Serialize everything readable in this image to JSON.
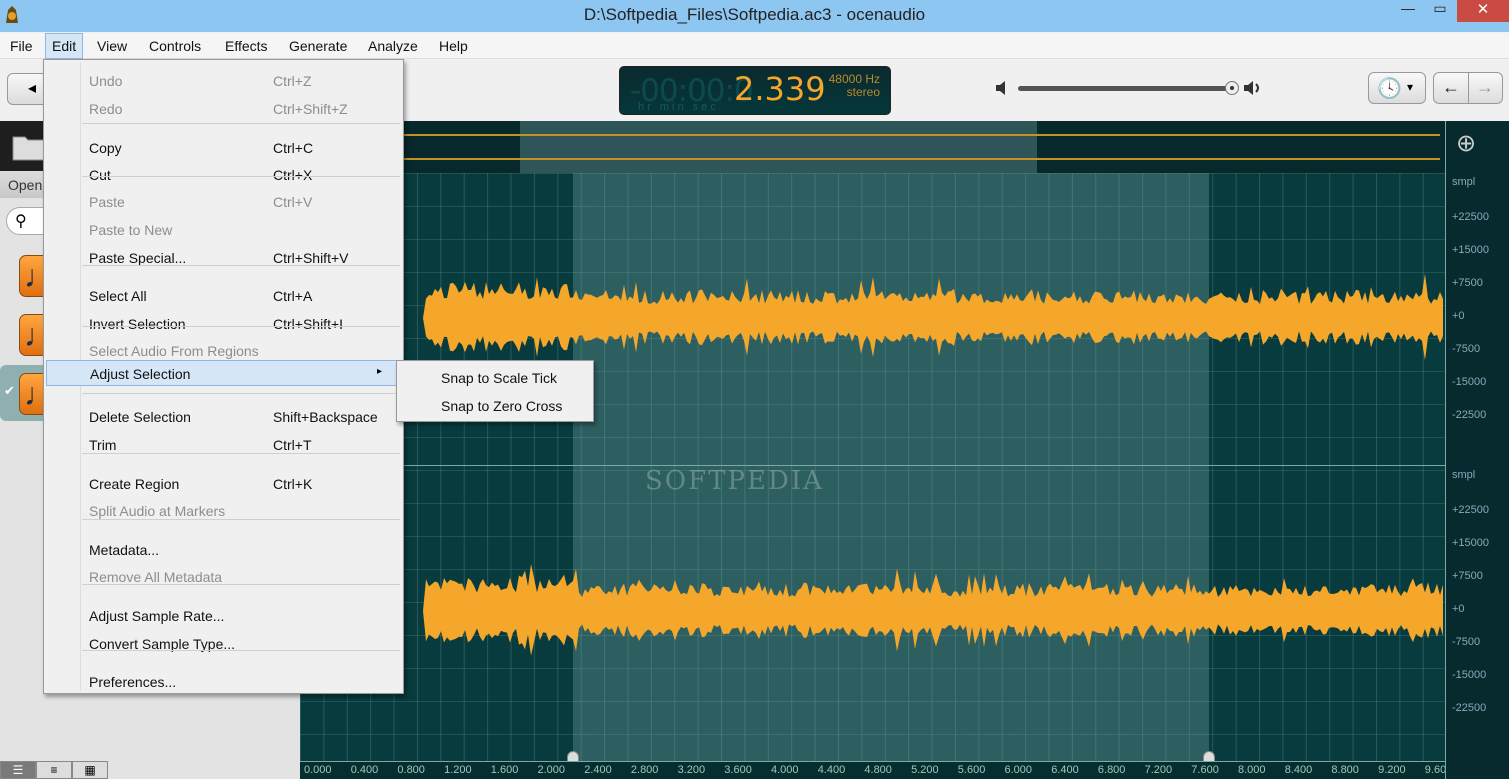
{
  "window": {
    "title": "D:\\Softpedia_Files\\Softpedia.ac3 - ocenaudio",
    "minimize_glyph": "—",
    "maximize_glyph": "▭",
    "close_glyph": "✕"
  },
  "menubar": {
    "items": [
      {
        "label": "File"
      },
      {
        "label": "Edit"
      },
      {
        "label": "View"
      },
      {
        "label": "Controls"
      },
      {
        "label": "Effects"
      },
      {
        "label": "Generate"
      },
      {
        "label": "Analyze"
      },
      {
        "label": "Help"
      }
    ],
    "active": "Edit"
  },
  "toolbar": {
    "sidebar_toggle_glyph": "◂",
    "time_display": {
      "dim_digits": "-00:00:0",
      "time": "2.339",
      "sample_rate": "48000 Hz",
      "channels": "stereo",
      "units": "hr   min sec"
    },
    "volume_percent": 100,
    "clock_glyph": "🕓",
    "dropdown_glyph": "▾",
    "back_glyph": "←",
    "forward_glyph": "→"
  },
  "sidebar": {
    "open_label": "Open",
    "search_glyph": "⚲",
    "view_modes": [
      "☰",
      "≡",
      "▦"
    ]
  },
  "edit_menu": {
    "items": [
      {
        "label": "Undo",
        "shortcut": "Ctrl+Z",
        "enabled": false
      },
      {
        "label": "Redo",
        "shortcut": "Ctrl+Shift+Z",
        "enabled": false
      },
      {
        "label": "Copy",
        "shortcut": "Ctrl+C",
        "enabled": true
      },
      {
        "label": "Cut",
        "shortcut": "Ctrl+X",
        "enabled": true
      },
      {
        "label": "Paste",
        "shortcut": "Ctrl+V",
        "enabled": false
      },
      {
        "label": "Paste to New",
        "shortcut": "",
        "enabled": false
      },
      {
        "label": "Paste Special...",
        "shortcut": "Ctrl+Shift+V",
        "enabled": true
      },
      {
        "label": "Select All",
        "shortcut": "Ctrl+A",
        "enabled": true
      },
      {
        "label": "Invert Selection",
        "shortcut": "Ctrl+Shift+I",
        "enabled": true
      },
      {
        "label": "Select Audio From Regions",
        "shortcut": "",
        "enabled": false
      },
      {
        "label": "Adjust Selection",
        "shortcut": "",
        "enabled": true,
        "submenu": true
      },
      {
        "label": "Delete Selection",
        "shortcut": "Shift+Backspace",
        "enabled": true
      },
      {
        "label": "Trim",
        "shortcut": "Ctrl+T",
        "enabled": true
      },
      {
        "label": "Create Region",
        "shortcut": "Ctrl+K",
        "enabled": true
      },
      {
        "label": "Split Audio at Markers",
        "shortcut": "",
        "enabled": false
      },
      {
        "label": "Metadata...",
        "shortcut": "",
        "enabled": true
      },
      {
        "label": "Remove All Metadata",
        "shortcut": "",
        "enabled": false
      },
      {
        "label": "Adjust Sample Rate...",
        "shortcut": "",
        "enabled": true
      },
      {
        "label": "Convert Sample Type...",
        "shortcut": "",
        "enabled": true
      },
      {
        "label": "Preferences...",
        "shortcut": "",
        "enabled": true
      }
    ],
    "submenu_arrow": "▸"
  },
  "adjust_selection_submenu": {
    "items": [
      {
        "label": "Snap to Scale Tick"
      },
      {
        "label": "Snap to Zero Cross"
      }
    ]
  },
  "waveform": {
    "watermark": "SOFTPEDIA",
    "selection_start_sec": 2.339,
    "selection_end_sec": 7.64,
    "zoom_glyph": "⊕",
    "amplitude_scale": {
      "unit": "smpl",
      "labels": [
        "+22500",
        "+15000",
        "+7500",
        "+0",
        "-7500",
        "-15000",
        "-22500"
      ]
    },
    "time_ruler": [
      "0.000",
      "0.400",
      "0.800",
      "1.200",
      "1.600",
      "2.000",
      "2.400",
      "2.800",
      "3.200",
      "3.600",
      "4.000",
      "4.400",
      "4.800",
      "5.200",
      "5.600",
      "6.000",
      "6.400",
      "6.800",
      "7.200",
      "7.600",
      "8.000",
      "8.400",
      "8.800",
      "9.200",
      "9.60"
    ]
  },
  "colors": {
    "waveform": "#f4a72a",
    "background": "#083b3e",
    "titlebar": "#8ec6f2",
    "menu_highlight": "#d5e6f6"
  }
}
